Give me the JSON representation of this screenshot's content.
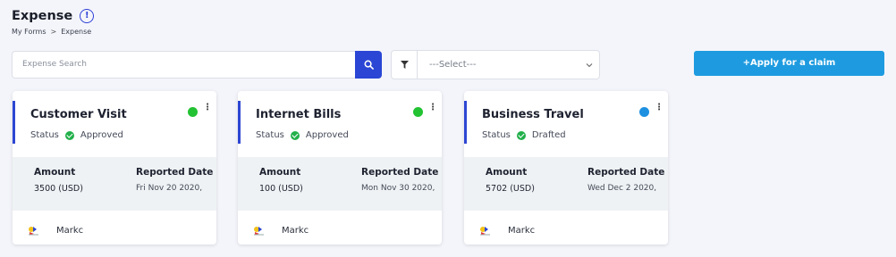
{
  "page": {
    "title": "Expense",
    "breadcrumb": [
      "My Forms",
      "Expense"
    ],
    "breadcrumb_separator": ">"
  },
  "toolbar": {
    "search_placeholder": "Expense Search",
    "select_value": "---Select---",
    "apply_label": "+Apply for a claim"
  },
  "colors": {
    "accent": "#2d46d3",
    "apply_button": "#1e9be0",
    "approved_dot": "#22c233",
    "drafted_dot": "#1e90e0"
  },
  "cards": [
    {
      "title": "Customer Visit",
      "status_label": "Status",
      "status": "Approved",
      "dot_color": "#22c233",
      "amount_label": "Amount",
      "amount": "3500 (USD)",
      "date_label": "Reported Date",
      "date": "Fri Nov 20 2020,",
      "user": "Markc"
    },
    {
      "title": "Internet Bills",
      "status_label": "Status",
      "status": "Approved",
      "dot_color": "#22c233",
      "amount_label": "Amount",
      "amount": "100 (USD)",
      "date_label": "Reported Date",
      "date": "Mon Nov 30 2020,",
      "user": "Markc"
    },
    {
      "title": "Business Travel",
      "status_label": "Status",
      "status": "Drafted",
      "dot_color": "#1e90e0",
      "amount_label": "Amount",
      "amount": "5702 (USD)",
      "date_label": "Reported Date",
      "date": "Wed Dec 2 2020,",
      "user": "Markc"
    }
  ]
}
